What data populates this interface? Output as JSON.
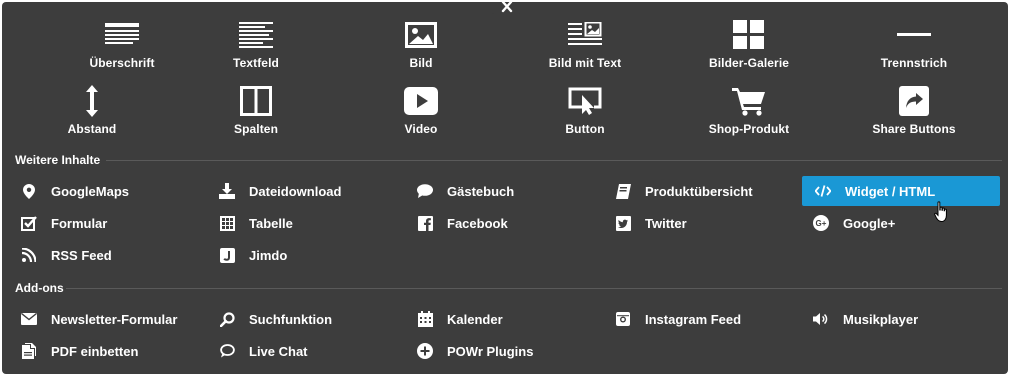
{
  "colors": {
    "panel": "#3d3d3d",
    "accent": "#1a98d5",
    "text": "#ffffff",
    "divider": "#5a5a5a"
  },
  "top_tiles": [
    {
      "label": "Überschrift",
      "icon": "heading-icon"
    },
    {
      "label": "Textfeld",
      "icon": "text-icon"
    },
    {
      "label": "Bild",
      "icon": "image-icon"
    },
    {
      "label": "Bild mit Text",
      "icon": "image-text-icon"
    },
    {
      "label": "Bilder-Galerie",
      "icon": "gallery-icon"
    },
    {
      "label": "Trennstrich",
      "icon": "divider-line-icon"
    },
    {
      "label": "Abstand",
      "icon": "spacing-icon"
    },
    {
      "label": "Spalten",
      "icon": "columns-icon"
    },
    {
      "label": "Video",
      "icon": "video-play-icon"
    },
    {
      "label": "Button",
      "icon": "button-cursor-icon"
    },
    {
      "label": "Shop-Produkt",
      "icon": "shopping-cart-icon"
    },
    {
      "label": "Share Buttons",
      "icon": "share-icon"
    }
  ],
  "sections": {
    "weitere": {
      "title": "Weitere Inhalte",
      "items": [
        {
          "label": "GoogleMaps",
          "icon": "map-pin-icon"
        },
        {
          "label": "Dateidownload",
          "icon": "download-icon"
        },
        {
          "label": "Gästebuch",
          "icon": "speech-bubble-icon"
        },
        {
          "label": "Produktübersicht",
          "icon": "catalog-icon"
        },
        {
          "label": "Widget / HTML",
          "icon": "code-icon",
          "active": true
        },
        {
          "label": "Formular",
          "icon": "checkbox-icon"
        },
        {
          "label": "Tabelle",
          "icon": "table-icon"
        },
        {
          "label": "Facebook",
          "icon": "facebook-icon"
        },
        {
          "label": "Twitter",
          "icon": "twitter-icon"
        },
        {
          "label": "Google+",
          "icon": "google-plus-icon"
        },
        {
          "label": "RSS Feed",
          "icon": "rss-icon"
        },
        {
          "label": "Jimdo",
          "icon": "jimdo-icon"
        }
      ]
    },
    "addons": {
      "title": "Add-ons",
      "items": [
        {
          "label": "Newsletter-Formular",
          "icon": "envelope-icon"
        },
        {
          "label": "Suchfunktion",
          "icon": "search-icon"
        },
        {
          "label": "Kalender",
          "icon": "calendar-icon"
        },
        {
          "label": "Instagram Feed",
          "icon": "instagram-icon"
        },
        {
          "label": "Musikplayer",
          "icon": "speaker-icon"
        },
        {
          "label": "PDF einbetten",
          "icon": "pdf-icon"
        },
        {
          "label": "Live Chat",
          "icon": "chat-icon"
        },
        {
          "label": "POWr Plugins",
          "icon": "plus-circle-icon"
        }
      ]
    }
  }
}
